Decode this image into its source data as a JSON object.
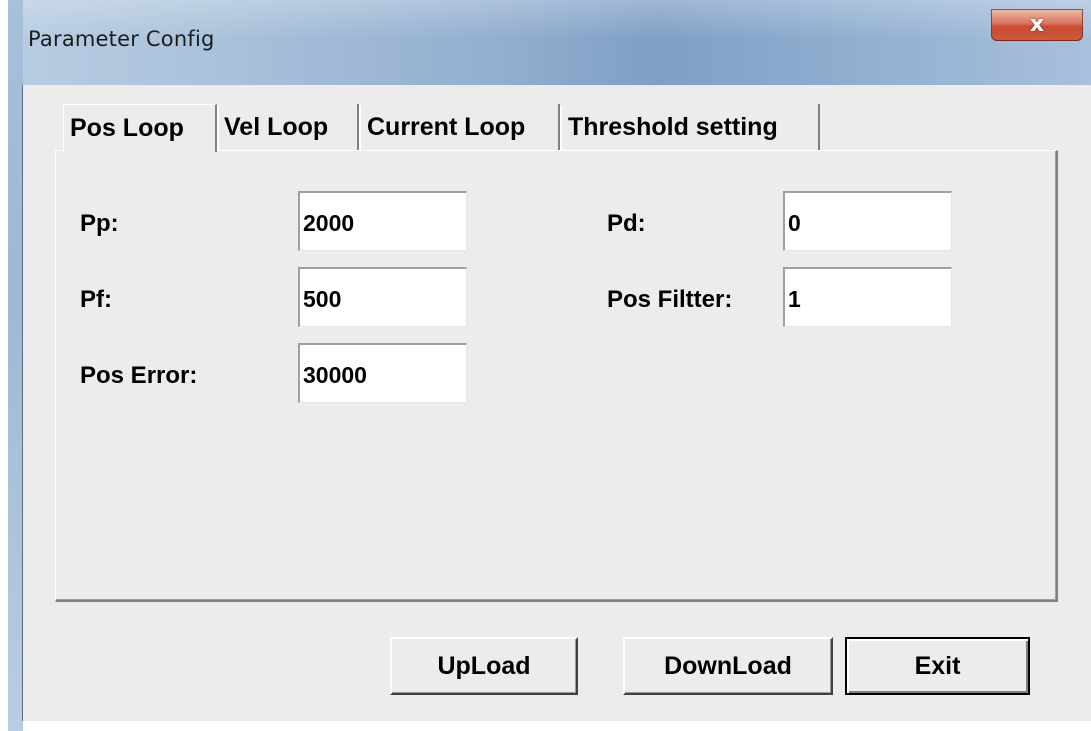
{
  "window": {
    "title": "Parameter Config",
    "close_label": "x"
  },
  "tabs": [
    {
      "label": "Pos Loop",
      "active": true
    },
    {
      "label": "Vel Loop",
      "active": false
    },
    {
      "label": "Current Loop",
      "active": false
    },
    {
      "label": "Threshold setting",
      "active": false
    }
  ],
  "fields": {
    "pp": {
      "label": "Pp:",
      "value": "2000"
    },
    "pf": {
      "label": "Pf:",
      "value": "500"
    },
    "pos_error": {
      "label": "Pos Error:",
      "value": "30000"
    },
    "pd": {
      "label": "Pd:",
      "value": "0"
    },
    "pos_filter": {
      "label": "Pos Filtter:",
      "value": "1"
    }
  },
  "buttons": {
    "upload": "UpLoad",
    "download": "DownLoad",
    "exit": "Exit"
  },
  "colors": {
    "close_button": "#c43a20",
    "dialog_background": "#ececec",
    "field_background": "#ffffff"
  }
}
